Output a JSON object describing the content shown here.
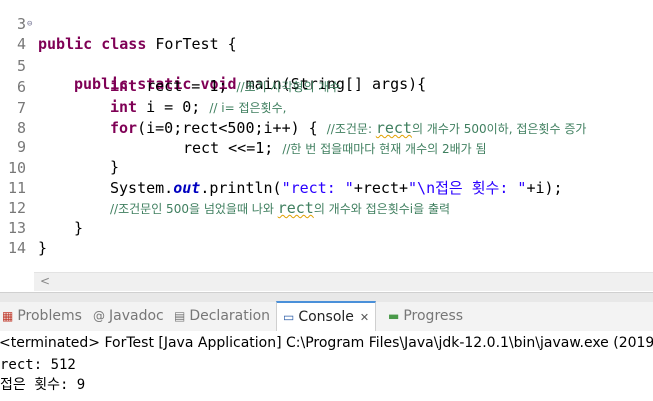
{
  "editor": {
    "line_numbers": [
      "3",
      "4",
      "5",
      "6",
      "7",
      "8",
      "9",
      "10",
      "11",
      "12",
      "13",
      "14"
    ],
    "l3": {
      "kw1": "public",
      "kw2": "class",
      "rest": " ForTest {"
    },
    "l4": {
      "kw1": "public",
      "kw2": "static",
      "kw3": "void",
      "rest": " main(String[] args){"
    },
    "l5": {
      "kw": "int",
      "code": " rect = 1; ",
      "comment": "//초기 사각형의 개수"
    },
    "l6": {
      "kw": "int",
      "code": " i = 0; ",
      "comment": "// i= 접은횟수,"
    },
    "l7": {
      "kw": "for",
      "code": "(i=0;rect<500;i++) { ",
      "comment_pre": "//조건문: ",
      "comment_sq": "rect",
      "comment_post": "의 개수가 500이하, 접은횟수 증가"
    },
    "l8": {
      "code": "rect <<=1; ",
      "comment": "//한 번 접을때마다 현재 개수의 2배가 됨"
    },
    "l9": {
      "code": "}"
    },
    "l10": {
      "code1": "System.",
      "field": "out",
      "code2": ".println(",
      "str1": "\"rect: \"",
      "code3": "+rect+",
      "str2": "\"\\n접은 횟수: \"",
      "code4": "+i);"
    },
    "l11": {
      "comment_pre": "//조건문인 500을 넘었을때 나와 ",
      "comment_sq": "rect",
      "comment_post": "의 개수와 접은횟수i을 출력"
    },
    "l12": {
      "code": "}"
    },
    "l13": {
      "code": "}"
    }
  },
  "scroll": {
    "left_arrow": "<"
  },
  "tabs": [
    {
      "label": "Problems",
      "icon": "problems-icon",
      "glyph": "▦"
    },
    {
      "label": "Javadoc",
      "icon": "javadoc-icon",
      "glyph": "@"
    },
    {
      "label": "Declaration",
      "icon": "declaration-icon",
      "glyph": "▤"
    },
    {
      "label": "Console",
      "icon": "console-icon",
      "glyph": "▭",
      "active": true,
      "close": "✕"
    },
    {
      "label": "Progress",
      "icon": "progress-icon",
      "glyph": "▬"
    }
  ],
  "console": {
    "header": "<terminated> ForTest [Java Application] C:\\Program Files\\Java\\jdk-12.0.1\\bin\\javaw.exe (2019",
    "out1": "rect: 512",
    "out2": "접은 횟수: 9"
  },
  "colors": {
    "keyword": "#7f0055",
    "string": "#2a00ff",
    "comment": "#3f7f5f",
    "field": "#0000c0",
    "active_tab_border": "#4a90d9"
  }
}
